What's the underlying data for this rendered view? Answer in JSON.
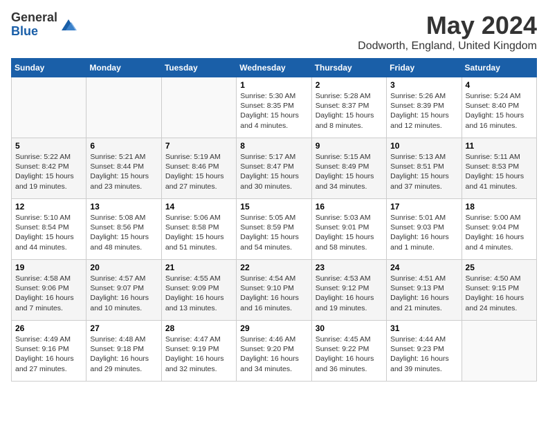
{
  "header": {
    "logo_general": "General",
    "logo_blue": "Blue",
    "title": "May 2024",
    "subtitle": "Dodworth, England, United Kingdom"
  },
  "weekdays": [
    "Sunday",
    "Monday",
    "Tuesday",
    "Wednesday",
    "Thursday",
    "Friday",
    "Saturday"
  ],
  "weeks": [
    [
      {
        "day": "",
        "info": ""
      },
      {
        "day": "",
        "info": ""
      },
      {
        "day": "",
        "info": ""
      },
      {
        "day": "1",
        "info": "Sunrise: 5:30 AM\nSunset: 8:35 PM\nDaylight: 15 hours and 4 minutes."
      },
      {
        "day": "2",
        "info": "Sunrise: 5:28 AM\nSunset: 8:37 PM\nDaylight: 15 hours and 8 minutes."
      },
      {
        "day": "3",
        "info": "Sunrise: 5:26 AM\nSunset: 8:39 PM\nDaylight: 15 hours and 12 minutes."
      },
      {
        "day": "4",
        "info": "Sunrise: 5:24 AM\nSunset: 8:40 PM\nDaylight: 15 hours and 16 minutes."
      }
    ],
    [
      {
        "day": "5",
        "info": "Sunrise: 5:22 AM\nSunset: 8:42 PM\nDaylight: 15 hours and 19 minutes."
      },
      {
        "day": "6",
        "info": "Sunrise: 5:21 AM\nSunset: 8:44 PM\nDaylight: 15 hours and 23 minutes."
      },
      {
        "day": "7",
        "info": "Sunrise: 5:19 AM\nSunset: 8:46 PM\nDaylight: 15 hours and 27 minutes."
      },
      {
        "day": "8",
        "info": "Sunrise: 5:17 AM\nSunset: 8:47 PM\nDaylight: 15 hours and 30 minutes."
      },
      {
        "day": "9",
        "info": "Sunrise: 5:15 AM\nSunset: 8:49 PM\nDaylight: 15 hours and 34 minutes."
      },
      {
        "day": "10",
        "info": "Sunrise: 5:13 AM\nSunset: 8:51 PM\nDaylight: 15 hours and 37 minutes."
      },
      {
        "day": "11",
        "info": "Sunrise: 5:11 AM\nSunset: 8:53 PM\nDaylight: 15 hours and 41 minutes."
      }
    ],
    [
      {
        "day": "12",
        "info": "Sunrise: 5:10 AM\nSunset: 8:54 PM\nDaylight: 15 hours and 44 minutes."
      },
      {
        "day": "13",
        "info": "Sunrise: 5:08 AM\nSunset: 8:56 PM\nDaylight: 15 hours and 48 minutes."
      },
      {
        "day": "14",
        "info": "Sunrise: 5:06 AM\nSunset: 8:58 PM\nDaylight: 15 hours and 51 minutes."
      },
      {
        "day": "15",
        "info": "Sunrise: 5:05 AM\nSunset: 8:59 PM\nDaylight: 15 hours and 54 minutes."
      },
      {
        "day": "16",
        "info": "Sunrise: 5:03 AM\nSunset: 9:01 PM\nDaylight: 15 hours and 58 minutes."
      },
      {
        "day": "17",
        "info": "Sunrise: 5:01 AM\nSunset: 9:03 PM\nDaylight: 16 hours and 1 minute."
      },
      {
        "day": "18",
        "info": "Sunrise: 5:00 AM\nSunset: 9:04 PM\nDaylight: 16 hours and 4 minutes."
      }
    ],
    [
      {
        "day": "19",
        "info": "Sunrise: 4:58 AM\nSunset: 9:06 PM\nDaylight: 16 hours and 7 minutes."
      },
      {
        "day": "20",
        "info": "Sunrise: 4:57 AM\nSunset: 9:07 PM\nDaylight: 16 hours and 10 minutes."
      },
      {
        "day": "21",
        "info": "Sunrise: 4:55 AM\nSunset: 9:09 PM\nDaylight: 16 hours and 13 minutes."
      },
      {
        "day": "22",
        "info": "Sunrise: 4:54 AM\nSunset: 9:10 PM\nDaylight: 16 hours and 16 minutes."
      },
      {
        "day": "23",
        "info": "Sunrise: 4:53 AM\nSunset: 9:12 PM\nDaylight: 16 hours and 19 minutes."
      },
      {
        "day": "24",
        "info": "Sunrise: 4:51 AM\nSunset: 9:13 PM\nDaylight: 16 hours and 21 minutes."
      },
      {
        "day": "25",
        "info": "Sunrise: 4:50 AM\nSunset: 9:15 PM\nDaylight: 16 hours and 24 minutes."
      }
    ],
    [
      {
        "day": "26",
        "info": "Sunrise: 4:49 AM\nSunset: 9:16 PM\nDaylight: 16 hours and 27 minutes."
      },
      {
        "day": "27",
        "info": "Sunrise: 4:48 AM\nSunset: 9:18 PM\nDaylight: 16 hours and 29 minutes."
      },
      {
        "day": "28",
        "info": "Sunrise: 4:47 AM\nSunset: 9:19 PM\nDaylight: 16 hours and 32 minutes."
      },
      {
        "day": "29",
        "info": "Sunrise: 4:46 AM\nSunset: 9:20 PM\nDaylight: 16 hours and 34 minutes."
      },
      {
        "day": "30",
        "info": "Sunrise: 4:45 AM\nSunset: 9:22 PM\nDaylight: 16 hours and 36 minutes."
      },
      {
        "day": "31",
        "info": "Sunrise: 4:44 AM\nSunset: 9:23 PM\nDaylight: 16 hours and 39 minutes."
      },
      {
        "day": "",
        "info": ""
      }
    ]
  ],
  "colors": {
    "header_bg": "#1a5fa8",
    "header_text": "#ffffff",
    "logo_blue": "#1a5fa8"
  }
}
